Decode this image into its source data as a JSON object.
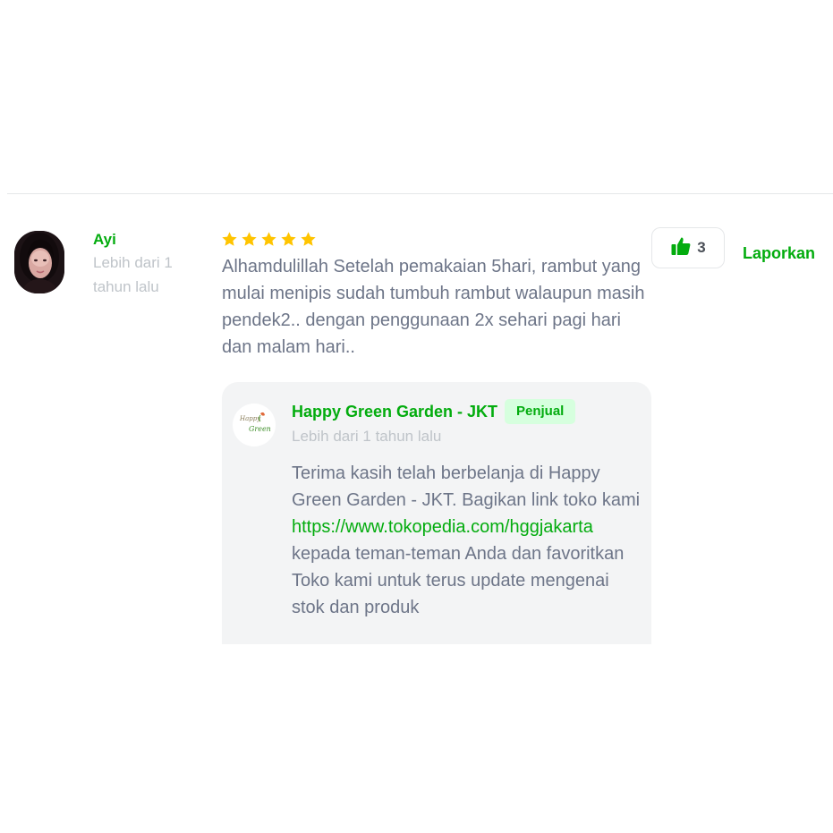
{
  "review": {
    "reviewer_name": "Ayi",
    "reviewer_time": "Lebih dari 1 tahun lalu",
    "rating": 5,
    "text": "Alhamdulillah Setelah pemakaian 5hari, rambut yang mulai menipis sudah tumbuh rambut walaupun masih pendek2.. dengan penggunaan 2x sehari pagi hari dan malam hari..",
    "like_count": "3",
    "report_label": "Laporkan"
  },
  "reply": {
    "seller_name": "Happy Green Garden - JKT",
    "badge": "Penjual",
    "time": "Lebih dari 1 tahun lalu",
    "logo_text": "Happy Green",
    "text_before": "Terima kasih telah berbelanja di Happy Green Garden - JKT. Bagikan link toko kami",
    "link": "https://www.tokopedia.com/hggjakarta",
    "text_after": "kepada teman-teman Anda dan favoritkan Toko kami untuk terus update mengenai stok dan produk"
  },
  "colors": {
    "accent": "#03ac0e",
    "star": "#ffc400",
    "text": "#6d7588",
    "muted": "#bfc4c9",
    "reply_bg": "#f3f4f5",
    "badge_bg": "#d6ffde"
  },
  "icons": {
    "star": "star-icon",
    "like": "thumbs-up-icon"
  }
}
